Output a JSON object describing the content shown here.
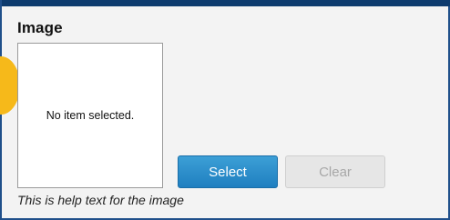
{
  "field": {
    "label": "Image",
    "preview_text": "No item selected.",
    "help_text": "This is help text for the image"
  },
  "buttons": {
    "select_label": "Select",
    "clear_label": "Clear",
    "clear_enabled": false
  },
  "colors": {
    "primary_button": "#2a8ccb",
    "disabled_button": "#e6e6e6",
    "marker": "#f6b91a",
    "frame_border": "#1f4f8a"
  }
}
